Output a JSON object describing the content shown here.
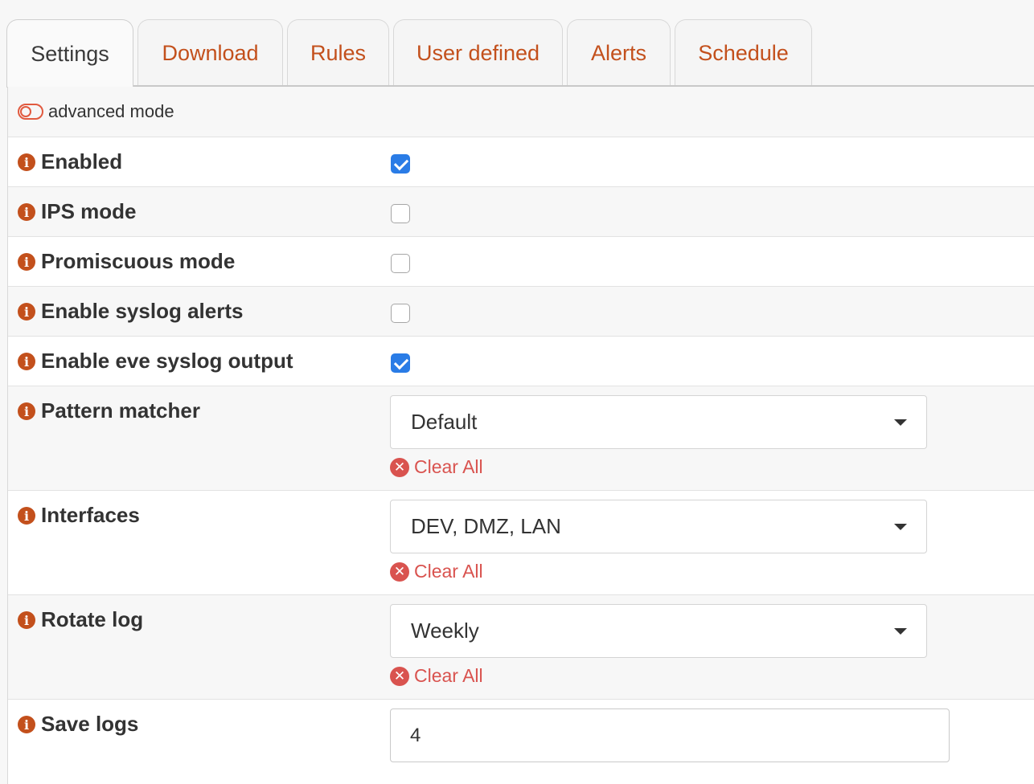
{
  "tabs": [
    {
      "label": "Settings",
      "active": true
    },
    {
      "label": "Download"
    },
    {
      "label": "Rules"
    },
    {
      "label": "User defined"
    },
    {
      "label": "Alerts"
    },
    {
      "label": "Schedule"
    }
  ],
  "advanced_mode": {
    "label": "advanced mode"
  },
  "fields": {
    "enabled": {
      "label": "Enabled",
      "checked": true
    },
    "ips_mode": {
      "label": "IPS mode",
      "checked": false
    },
    "promiscuous_mode": {
      "label": "Promiscuous mode",
      "checked": false
    },
    "syslog_alerts": {
      "label": "Enable syslog alerts",
      "checked": false
    },
    "eve_syslog": {
      "label": "Enable eve syslog output",
      "checked": true
    },
    "pattern_matcher": {
      "label": "Pattern matcher",
      "value": "Default"
    },
    "interfaces": {
      "label": "Interfaces",
      "value": "DEV, DMZ, LAN"
    },
    "rotate_log": {
      "label": "Rotate log",
      "value": "Weekly"
    },
    "save_logs": {
      "label": "Save logs",
      "value": "4"
    }
  },
  "clear_all_label": "Clear All",
  "colors": {
    "accent": "#c3501c",
    "danger": "#d9534f",
    "check": "#2a7ce6"
  }
}
